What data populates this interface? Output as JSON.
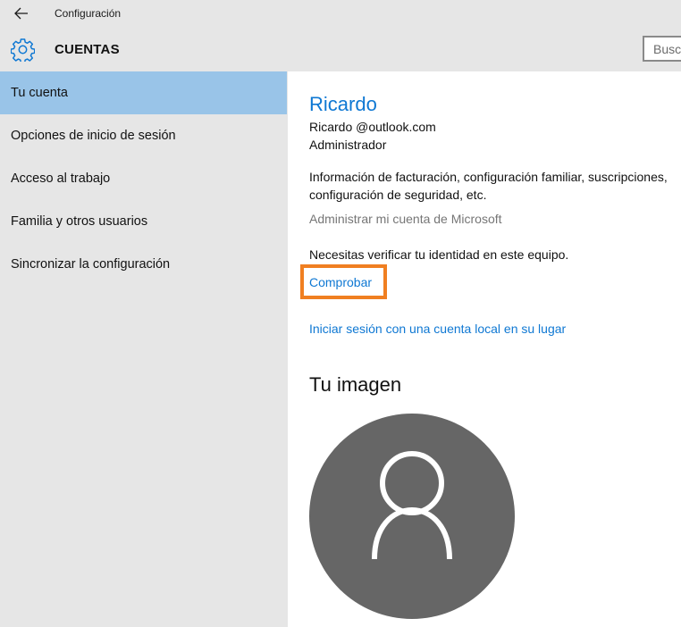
{
  "titlebar": {
    "back_icon": "arrow-left-icon",
    "title": "Configuración"
  },
  "header": {
    "icon": "gear-icon",
    "title": "CUENTAS",
    "search_placeholder": "Buscar"
  },
  "sidebar": {
    "selected_index": 0,
    "selected_color": "#99c4e8",
    "items": [
      {
        "label": "Tu cuenta"
      },
      {
        "label": "Opciones de inicio de sesión"
      },
      {
        "label": "Acceso al trabajo"
      },
      {
        "label": "Familia y otros usuarios"
      },
      {
        "label": "Sincronizar la configuración"
      }
    ]
  },
  "account": {
    "name": "Ricardo",
    "email": "Ricardo @outlook.com",
    "role": "Administrador",
    "billing_info": "Información de facturación, configuración familiar, suscripciones, configuración de seguridad, etc.",
    "manage_link": "Administrar mi cuenta de Microsoft",
    "verify_text": "Necesitas verificar tu identidad en este equipo.",
    "verify_link": "Comprobar",
    "local_account_link": "Iniciar sesión con una cuenta local en su lugar"
  },
  "picture": {
    "title": "Tu imagen",
    "avatar_icon": "user-silhouette-icon"
  },
  "colors": {
    "accent": "#0f78d3",
    "highlight_border": "#f07f21",
    "chrome_background": "#e6e6e6",
    "avatar_background": "#666666"
  }
}
